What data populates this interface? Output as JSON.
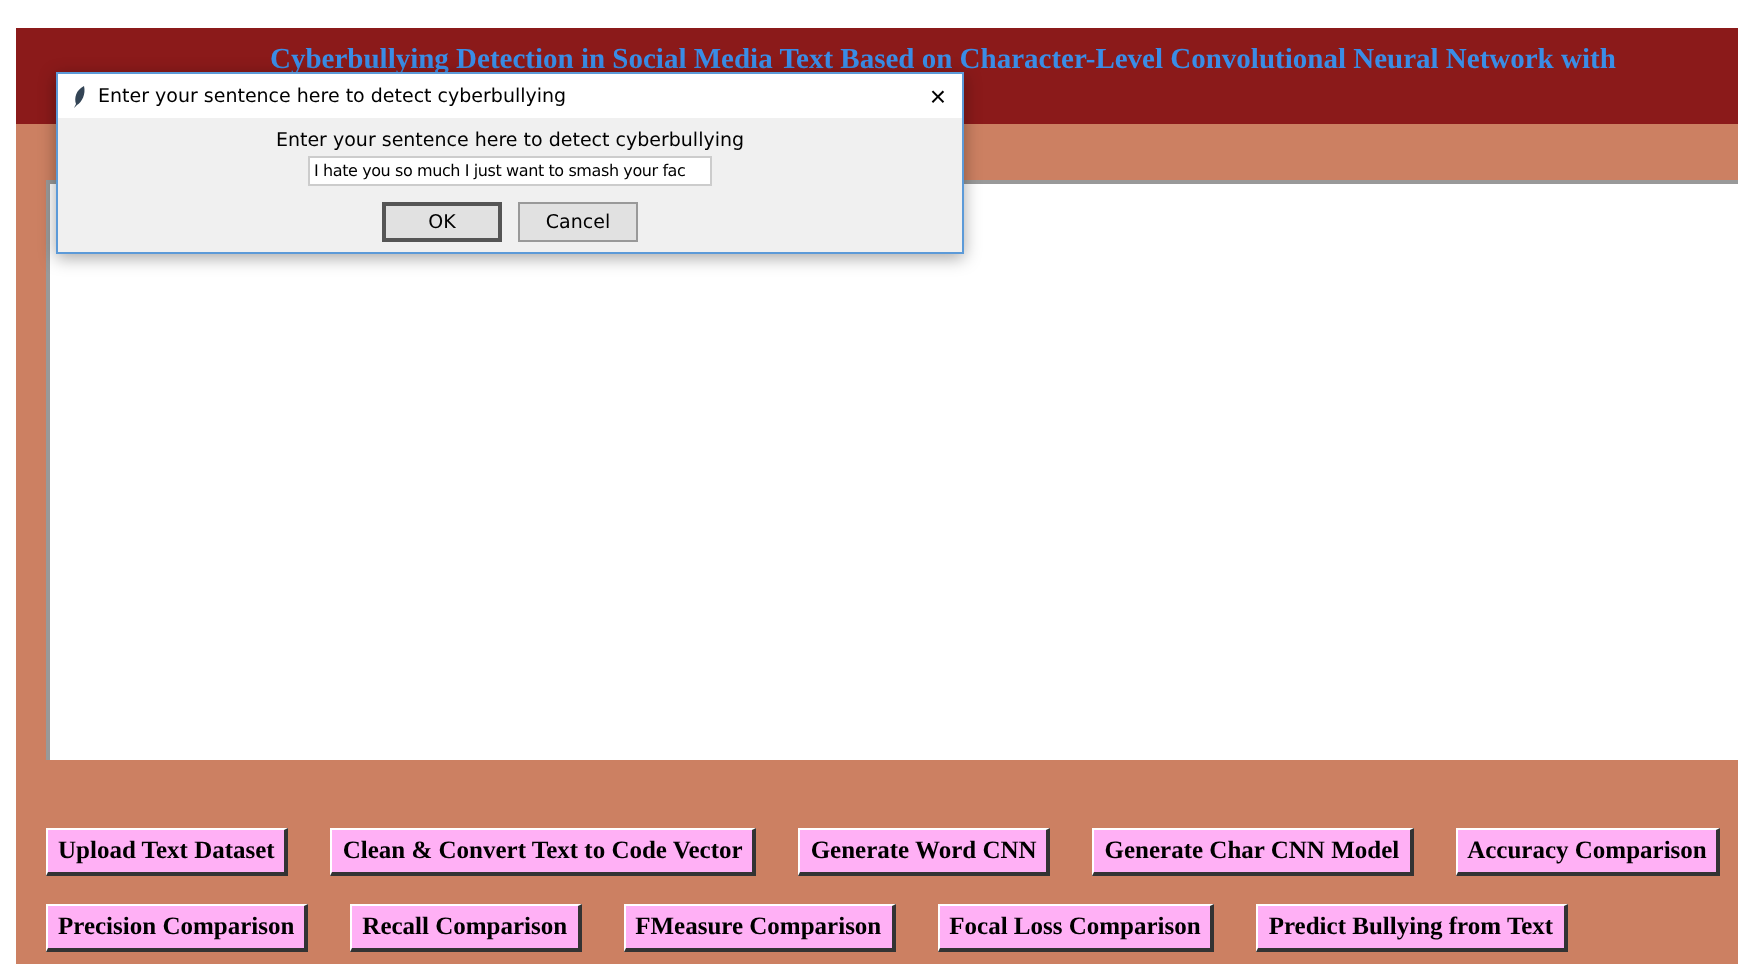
{
  "app": {
    "title": "Cyberbullying Detection in Social Media Text Based on Character-Level Convolutional Neural Network with"
  },
  "dialog": {
    "title": "Enter your sentence here  to detect cyberbullying",
    "prompt": "Enter your sentence here to detect cyberbullying",
    "value": "I hate you so much I just want to smash your fac",
    "close": "×",
    "buttons": [
      {
        "label": "OK",
        "default": true
      },
      {
        "label": "Cancel",
        "default": false
      }
    ]
  },
  "button_rows": [
    [
      "Upload Text Dataset",
      "Clean & Convert Text to Code Vector",
      "Generate Word CNN",
      "Generate Char CNN Model",
      "Accuracy Comparison"
    ],
    [
      "Precision Comparison",
      "Recall Comparison",
      "FMeasure Comparison",
      "Focal Loss Comparison",
      "Predict Bullying from Text"
    ]
  ]
}
